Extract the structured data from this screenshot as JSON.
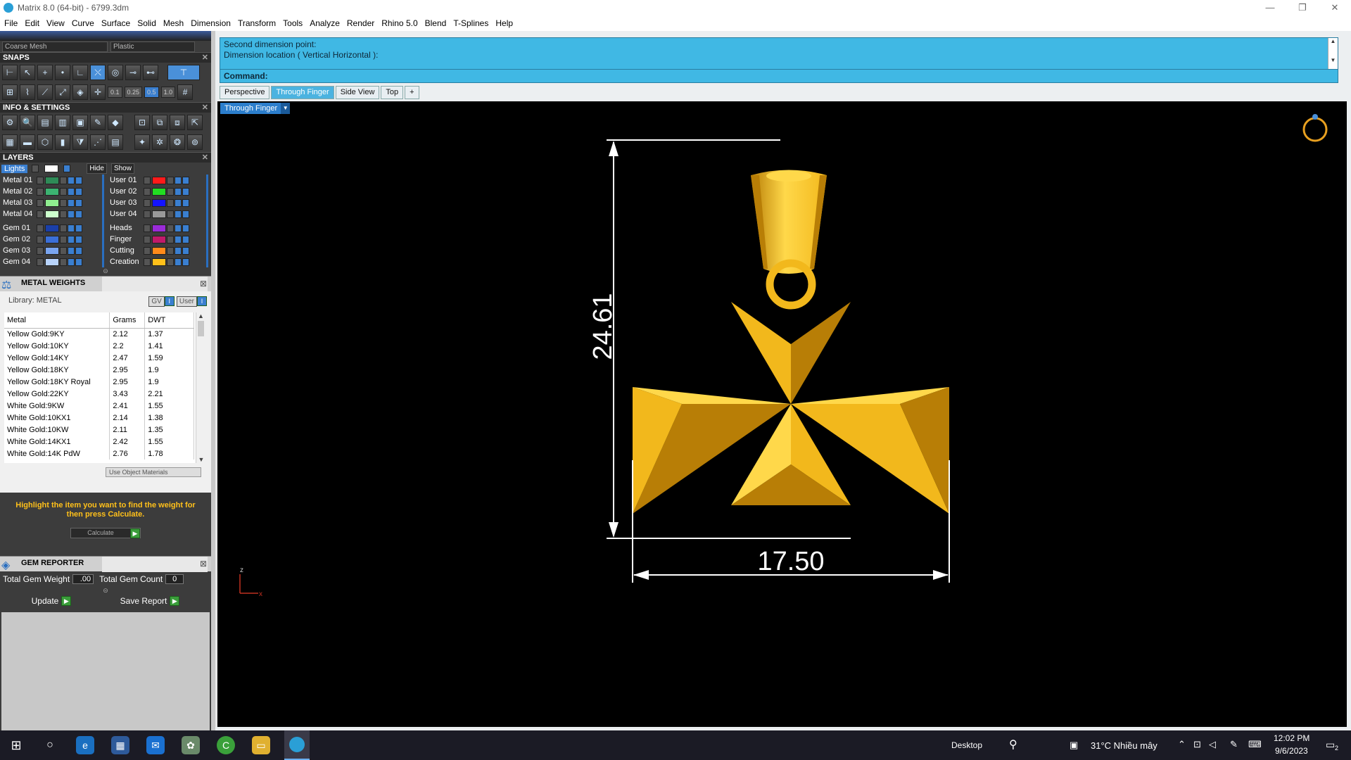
{
  "window": {
    "title": "Matrix 8.0 (64-bit) - 6799.3dm",
    "min": "—",
    "max": "❐",
    "close": "✕"
  },
  "menu": [
    "File",
    "Edit",
    "View",
    "Curve",
    "Surface",
    "Solid",
    "Mesh",
    "Dimension",
    "Transform",
    "Tools",
    "Analyze",
    "Render",
    "Rhino 5.0",
    "Blend",
    "T-Splines",
    "Help"
  ],
  "top_dropdowns": {
    "mesh": "Coarse Mesh",
    "material": "Plastic"
  },
  "snaps": {
    "title": "SNAPS",
    "vals": [
      "0.1",
      "0.25",
      "0.5",
      "1.0"
    ]
  },
  "info": {
    "title": "INFO & SETTINGS"
  },
  "layers": {
    "title": "LAYERS",
    "lights": "Lights",
    "hide": "Hide",
    "show": "Show",
    "left": [
      {
        "name": "Metal 01",
        "color": "#2e8b57"
      },
      {
        "name": "Metal 02",
        "color": "#3cb371"
      },
      {
        "name": "Metal 03",
        "color": "#90ee90"
      },
      {
        "name": "Metal 04",
        "color": "#ccffcc"
      },
      {
        "name": "Gem 01",
        "color": "#1a3fa8"
      },
      {
        "name": "Gem 02",
        "color": "#3b6fd8"
      },
      {
        "name": "Gem 03",
        "color": "#7aa5f0"
      },
      {
        "name": "Gem 04",
        "color": "#b8d3fb"
      }
    ],
    "right": [
      {
        "name": "User 01",
        "color": "#ff1a1a"
      },
      {
        "name": "User 02",
        "color": "#22dd22"
      },
      {
        "name": "User 03",
        "color": "#1414ff"
      },
      {
        "name": "User 04",
        "color": "#999999"
      },
      {
        "name": "Heads",
        "color": "#9a2bd8"
      },
      {
        "name": "Finger",
        "color": "#c01a6a"
      },
      {
        "name": "Cutting",
        "color": "#ff8a1a"
      },
      {
        "name": "Creation",
        "color": "#ffc01a"
      }
    ]
  },
  "metal_weights": {
    "title": "METAL WEIGHTS",
    "library": "Library: METAL",
    "gv": "GV",
    "user": "User",
    "headers": [
      "Metal",
      "Grams",
      "DWT"
    ],
    "rows": [
      [
        "Yellow Gold:9KY",
        "2.12",
        "1.37"
      ],
      [
        "Yellow Gold:10KY",
        "2.2",
        "1.41"
      ],
      [
        "Yellow Gold:14KY",
        "2.47",
        "1.59"
      ],
      [
        "Yellow Gold:18KY",
        "2.95",
        "1.9"
      ],
      [
        "Yellow Gold:18KY Royal",
        "2.95",
        "1.9"
      ],
      [
        "Yellow Gold:22KY",
        "3.43",
        "2.21"
      ],
      [
        "White Gold:9KW",
        "2.41",
        "1.55"
      ],
      [
        "White Gold:10KX1",
        "2.14",
        "1.38"
      ],
      [
        "White Gold:10KW",
        "2.11",
        "1.35"
      ],
      [
        "White Gold:14KX1",
        "2.42",
        "1.55"
      ],
      [
        "White Gold:14K PdW",
        "2.76",
        "1.78"
      ]
    ],
    "use_object": "Use Object Materials",
    "hint": "Highlight the item you want to find the weight for then press Calculate.",
    "calculate": "Calculate"
  },
  "gem_reporter": {
    "title": "GEM REPORTER",
    "weight_label": "Total Gem Weight",
    "weight": ".00",
    "count_label": "Total Gem Count",
    "count": "0",
    "update": "Update",
    "save": "Save Report"
  },
  "command": {
    "line1": "Second dimension point:",
    "line2": "Dimension location ( Vertical  Horizontal ):",
    "prompt": "Command:"
  },
  "tabs": [
    "Perspective",
    "Through Finger",
    "Side View",
    "Top",
    "+"
  ],
  "viewport": {
    "label": "Through Finger",
    "dim_vertical": "24.61",
    "dim_horizontal": "17.50",
    "axis_z": "z",
    "axis_x": "x",
    "colors": {
      "gold_light": "#ffd84a",
      "gold_mid": "#f2b81c",
      "gold_dark": "#b87e06"
    }
  },
  "taskbar": {
    "desktop": "Desktop",
    "weather": "31°C  Nhiều mây",
    "time": "12:02 PM",
    "date": "9/6/2023",
    "notif": "2"
  }
}
